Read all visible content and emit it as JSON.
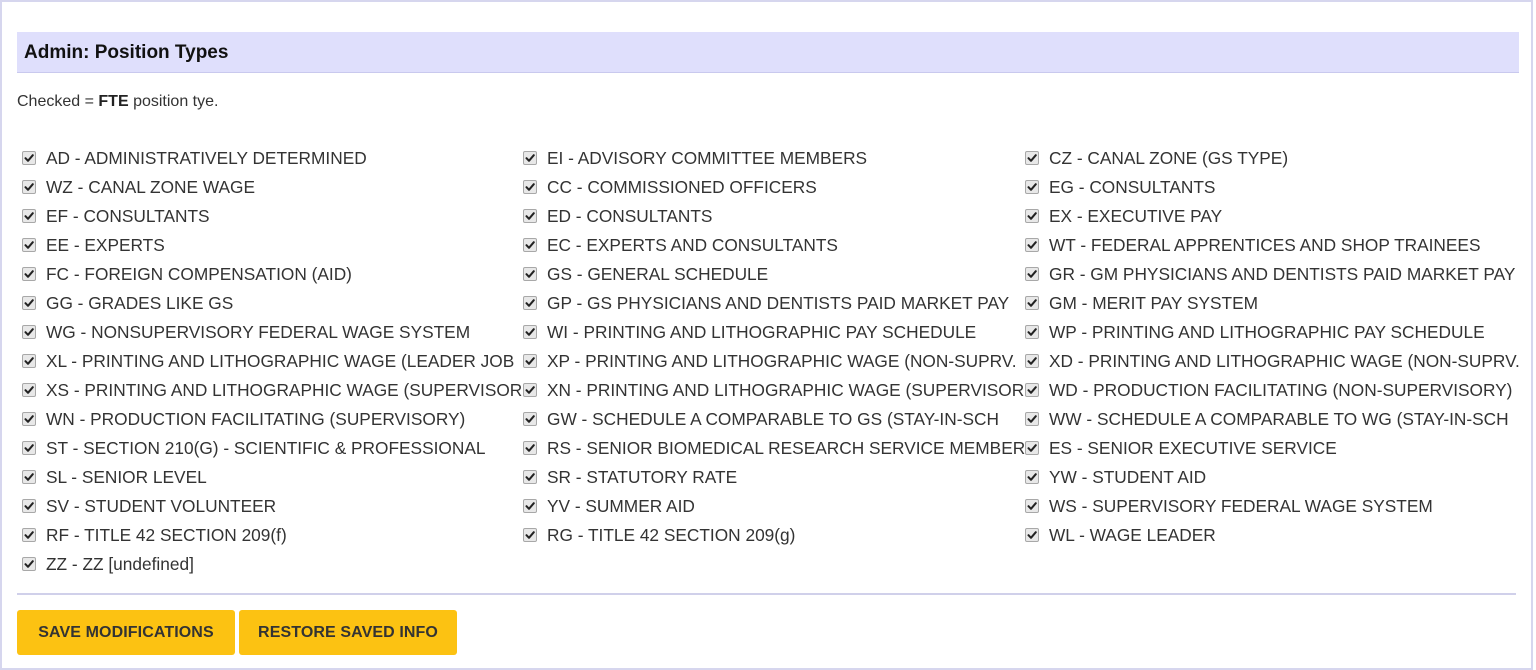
{
  "panel": {
    "title": "Admin: Position Types",
    "note_prefix": "Checked =",
    "note_bold": "FTE",
    "note_suffix": "position tye."
  },
  "columns": [
    [
      {
        "label": "AD - ADMINISTRATIVELY DETERMINED",
        "checked": true
      },
      {
        "label": "WZ - CANAL ZONE WAGE",
        "checked": true
      },
      {
        "label": "EF - CONSULTANTS",
        "checked": true
      },
      {
        "label": "EE - EXPERTS",
        "checked": true
      },
      {
        "label": "FC - FOREIGN COMPENSATION (AID)",
        "checked": true
      },
      {
        "label": "GG - GRADES LIKE GS",
        "checked": true
      },
      {
        "label": "WG - NONSUPERVISORY FEDERAL WAGE SYSTEM",
        "checked": true
      },
      {
        "label": "XL - PRINTING AND LITHOGRAPHIC WAGE (LEADER JOB",
        "checked": true
      },
      {
        "label": "XS - PRINTING AND LITHOGRAPHIC WAGE (SUPERVISOR",
        "checked": true
      },
      {
        "label": "WN - PRODUCTION FACILITATING (SUPERVISORY)",
        "checked": true
      },
      {
        "label": "ST - SECTION 210(G) - SCIENTIFIC & PROFESSIONAL",
        "checked": true
      },
      {
        "label": "SL - SENIOR LEVEL",
        "checked": true
      },
      {
        "label": "SV - STUDENT VOLUNTEER",
        "checked": true
      },
      {
        "label": "RF - TITLE 42 SECTION 209(f)",
        "checked": true
      },
      {
        "label": "ZZ - ZZ [undefined]",
        "checked": true
      }
    ],
    [
      {
        "label": "EI - ADVISORY COMMITTEE MEMBERS",
        "checked": true
      },
      {
        "label": "CC - COMMISSIONED OFFICERS",
        "checked": true
      },
      {
        "label": "ED - CONSULTANTS",
        "checked": true
      },
      {
        "label": "EC - EXPERTS AND CONSULTANTS",
        "checked": true
      },
      {
        "label": "GS - GENERAL SCHEDULE",
        "checked": true
      },
      {
        "label": "GP - GS PHYSICIANS AND DENTISTS PAID MARKET PAY",
        "checked": true
      },
      {
        "label": "WI - PRINTING AND LITHOGRAPHIC PAY SCHEDULE",
        "checked": true
      },
      {
        "label": "XP - PRINTING AND LITHOGRAPHIC WAGE (NON-SUPRV.",
        "checked": true
      },
      {
        "label": "XN - PRINTING AND LITHOGRAPHIC WAGE (SUPERVISOR",
        "checked": true
      },
      {
        "label": "GW - SCHEDULE A COMPARABLE TO GS (STAY-IN-SCH",
        "checked": true
      },
      {
        "label": "RS - SENIOR BIOMEDICAL RESEARCH SERVICE MEMBER",
        "checked": true
      },
      {
        "label": "SR - STATUTORY RATE",
        "checked": true
      },
      {
        "label": "YV - SUMMER AID",
        "checked": true
      },
      {
        "label": "RG - TITLE 42 SECTION 209(g)",
        "checked": true
      }
    ],
    [
      {
        "label": "CZ - CANAL ZONE (GS TYPE)",
        "checked": true
      },
      {
        "label": "EG - CONSULTANTS",
        "checked": true
      },
      {
        "label": "EX - EXECUTIVE PAY",
        "checked": true
      },
      {
        "label": "WT - FEDERAL APPRENTICES AND SHOP TRAINEES",
        "checked": true
      },
      {
        "label": "GR - GM PHYSICIANS AND DENTISTS PAID MARKET PAY",
        "checked": true
      },
      {
        "label": "GM - MERIT PAY SYSTEM",
        "checked": true
      },
      {
        "label": "WP - PRINTING AND LITHOGRAPHIC PAY SCHEDULE",
        "checked": true
      },
      {
        "label": "XD - PRINTING AND LITHOGRAPHIC WAGE (NON-SUPRV.",
        "checked": true
      },
      {
        "label": "WD - PRODUCTION FACILITATING (NON-SUPERVISORY)",
        "checked": true
      },
      {
        "label": "WW - SCHEDULE A COMPARABLE TO WG (STAY-IN-SCH",
        "checked": true
      },
      {
        "label": "ES - SENIOR EXECUTIVE SERVICE",
        "checked": true
      },
      {
        "label": "YW - STUDENT AID",
        "checked": true
      },
      {
        "label": "WS - SUPERVISORY FEDERAL WAGE SYSTEM",
        "checked": true
      },
      {
        "label": "WL - WAGE LEADER",
        "checked": true
      }
    ]
  ],
  "buttons": {
    "save": "SAVE MODIFICATIONS",
    "restore": "RESTORE SAVED INFO"
  },
  "colors": {
    "header_bg": "#dfdffc",
    "button_bg": "#fcc212",
    "frame_border": "#d6d6ee"
  },
  "icons": {
    "checkbox": "checkmark-icon"
  }
}
